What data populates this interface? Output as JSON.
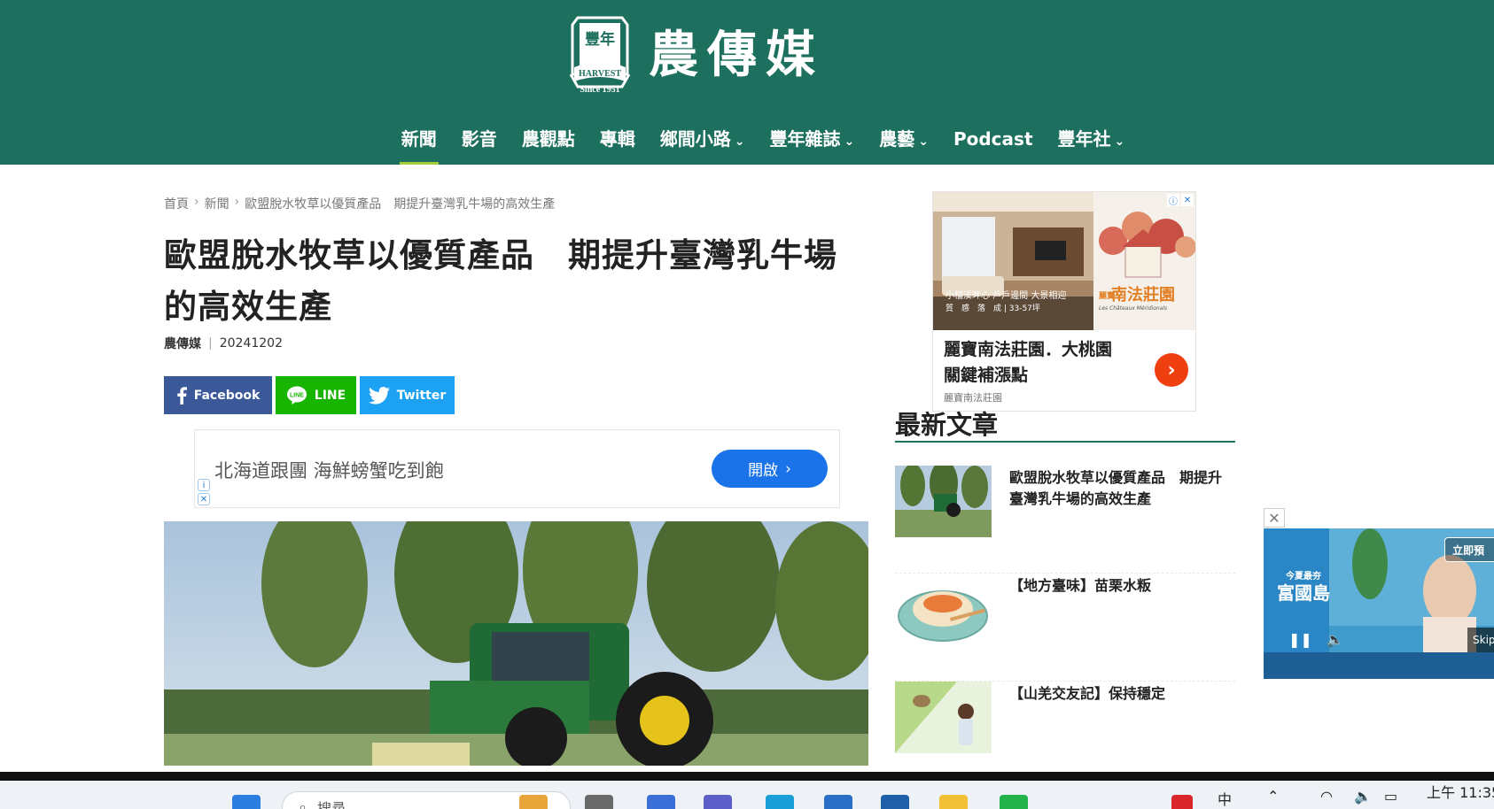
{
  "header": {
    "logo_text": "農傳媒",
    "logo_badge_cn": "豐年",
    "logo_badge_en": "HARVEST",
    "logo_since": "Since 1951",
    "brand_color": "#1d6f5e",
    "accent_color": "#a7cf3a",
    "nav": [
      {
        "label": "新聞",
        "active": true,
        "dropdown": false
      },
      {
        "label": "影音",
        "active": false,
        "dropdown": false
      },
      {
        "label": "農觀點",
        "active": false,
        "dropdown": false
      },
      {
        "label": "專輯",
        "active": false,
        "dropdown": false
      },
      {
        "label": "鄉間小路",
        "active": false,
        "dropdown": true
      },
      {
        "label": "豐年雜誌",
        "active": false,
        "dropdown": true
      },
      {
        "label": "農藝",
        "active": false,
        "dropdown": true
      },
      {
        "label": "Podcast",
        "active": false,
        "dropdown": false
      },
      {
        "label": "豐年社",
        "active": false,
        "dropdown": true
      }
    ]
  },
  "breadcrumb": {
    "home": "首頁",
    "section": "新聞",
    "current": "歐盟脫水牧草以優質產品　期提升臺灣乳牛場的高效生產"
  },
  "article": {
    "title_line1": "歐盟脫水牧草以優質產品　期提升臺灣乳牛場",
    "title_line2": "的高效生產",
    "author": "農傳媒",
    "date": "20241202"
  },
  "share": {
    "facebook": "Facebook",
    "line": "LINE",
    "twitter": "Twitter",
    "facebook_color": "#3b5998",
    "line_color": "#17b400",
    "twitter_color": "#1da1f2"
  },
  "inline_ad": {
    "text": "北海道跟團 海鮮螃蟹吃到飽",
    "cta": "開啟"
  },
  "side_ad": {
    "caption_line1": "麗寶南法莊園．大桃園",
    "caption_line2": "關鍵補漲點",
    "source": "麗寶南法莊園",
    "image_overlay_line1": "小檔溪畔心 戶戶邊間 大景相迎",
    "image_overlay_line2": "質　感　落　成 | 33-57坪",
    "estate_name": "南法莊園",
    "estate_name_prefix": "麗寶",
    "estate_tagline": "Les Châteaux Méridionals"
  },
  "latest": {
    "heading": "最新文章",
    "items": [
      {
        "title": "歐盟脫水牧草以優質產品　期提升臺灣乳牛場的高效生產"
      },
      {
        "title": "【地方臺味】苗栗水粄"
      },
      {
        "title": "【山羌交友記】保持穩定"
      }
    ]
  },
  "float_ad": {
    "cta": "立即預",
    "skip": "Skip",
    "brand": "富國島",
    "brand_prefix": "今夏最夯"
  },
  "taskbar": {
    "search_placeholder": "搜尋",
    "ime": "中",
    "clock": "上午 11:35"
  }
}
